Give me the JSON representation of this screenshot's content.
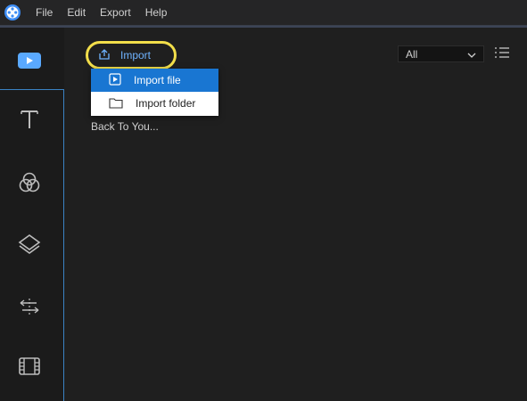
{
  "menubar": {
    "items": [
      "File",
      "Edit",
      "Export",
      "Help"
    ],
    "logo_icon": "app-logo-icon"
  },
  "toolbar": {
    "tools": [
      {
        "name": "media",
        "icon": "play-media-icon",
        "active": true
      },
      {
        "name": "text",
        "icon": "text-icon"
      },
      {
        "name": "filters",
        "icon": "filters-icon"
      },
      {
        "name": "overlays",
        "icon": "layers-icon"
      },
      {
        "name": "transitions",
        "icon": "transitions-icon"
      },
      {
        "name": "elements",
        "icon": "film-strip-icon"
      }
    ]
  },
  "import": {
    "label": "Import",
    "menu": [
      {
        "label": "Import file",
        "icon": "video-file-icon",
        "active": true
      },
      {
        "label": "Import folder",
        "icon": "folder-icon"
      }
    ]
  },
  "media": {
    "caption": "Back To You..."
  },
  "filter": {
    "selected": "All"
  },
  "colors": {
    "accent": "#1976d2",
    "highlight": "#f2de4a",
    "link": "#6fb3ff"
  }
}
